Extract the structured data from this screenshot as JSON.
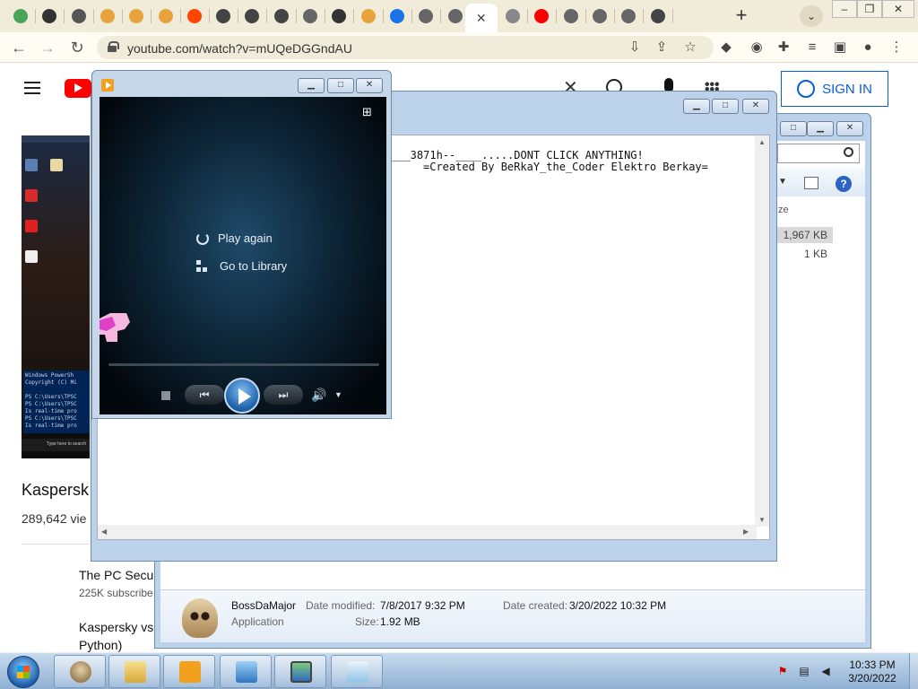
{
  "browser": {
    "url": "youtube.com/watch?v=mUQeDGGndAU",
    "tab_close": "✕",
    "new_tab": "+",
    "tab_favicon_colors": [
      "#4aa35a",
      "#333",
      "#555",
      "#e8a33c",
      "#e8a33c",
      "#e8a33c",
      "#ff4500",
      "#444",
      "#444",
      "#444",
      "#666",
      "#333",
      "#e8a33c",
      "#1a73e8",
      "#666",
      "#666",
      "#1a73e8",
      "#888",
      "#ff0000",
      "#666",
      "#666",
      "#666",
      "#444"
    ]
  },
  "youtube": {
    "sign_in": "SIGN IN",
    "video_title": "Kaspersk",
    "views": "289,642 vie",
    "channel": "The PC Secu",
    "subscribers": "225K subscribe",
    "related_title": "Kaspersky vs Python)"
  },
  "notepad": {
    "line1": "___3871h--____.....DONT CLICK ANYTHING!",
    "line2": "=Created By BeRkaY_the_Coder Elektro Berkay="
  },
  "explorer": {
    "col_size": "ze",
    "size1": "1,967 KB",
    "size2": "1 KB",
    "file_name": "BossDaMajor",
    "file_type": "Application",
    "date_modified_label": "Date modified:",
    "date_modified": "7/8/2017 9:32 PM",
    "date_created_label": "Date created:",
    "date_created": "3/20/2022 10:32 PM",
    "size_label": "Size:",
    "size": "1.92 MB"
  },
  "player": {
    "play_again": "Play again",
    "go_to_library": "Go to Library"
  },
  "video_thumb": {
    "ps_lines": "Windows PowerSh\nCopyright (C) Mi\n\nPS C:\\Users\\TPSC\nPS C:\\Users\\TPSC\nIs real-time pro\nPS C:\\Users\\TPSC\nIs real-time pro",
    "searchbox": "Type here to search"
  },
  "taskbar": {
    "time": "10:33 PM",
    "date": "3/20/2022"
  }
}
